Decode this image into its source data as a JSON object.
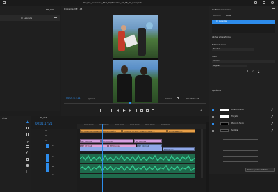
{
  "app": {
    "title_bar": "Projeto_Comissao_ESD_Nl_Trabalho_30_38_31_Completo",
    "accent": "#2d8ceb"
  },
  "left_panel": {
    "title": "ME_118",
    "folder_label": "Cl_Legenda"
  },
  "program_monitor": {
    "title": "Programa: ME_118",
    "timecode_current": "00:01:17:21",
    "fit_label": "Ajustar",
    "quality_label": "Inteira",
    "timecode_total": "00:03:04:16"
  },
  "essential_graphics": {
    "title": "Gráficos essenciais",
    "tab_browse": "Procurar",
    "tab_edit": "Editar",
    "layer_label": "Cl_Legenda",
    "section_align": "Alinhar e transformar",
    "section_styles": "Estilos de Texto",
    "style_value": "Nenhum",
    "section_text": "Texto",
    "font_value": "Verdana",
    "font_style": "Regular",
    "section_appearance": "Aparência",
    "appearance_rows": [
      "Preenchimento",
      "Traçado",
      "Plano de fundo",
      "Sombra"
    ],
    "apply_button": "Definir o padrão de fontes"
  },
  "tools": {
    "title": "Mídia"
  },
  "timeline": {
    "sequence_tab": "ME_118",
    "timecode": "00:01:17:21",
    "ruler_labels": [
      "00:00:45:00",
      "00:01:00:00",
      "00:01:15:00",
      "00:01:30:00",
      "00:01:45:00",
      "00:02:00:00"
    ],
    "track_labels": [
      "V4",
      "V3",
      "V2",
      "V1",
      "A1",
      "A2",
      "A3"
    ],
    "caption_clips": [
      "a coisa chamada aqui ta pedaço além.",
      "Então ali te quis, aprendi coisas ...",
      "a mulheres no..."
    ],
    "v2_clips": [
      "ME_08.mp4",
      "ME_09.mp4",
      "ME_08.mp4"
    ],
    "v1_clips": [
      "ME_07.mp4",
      "ME_08.mp4",
      "ME_09.mp4",
      "ME_09.mp4"
    ],
    "colors": {
      "caption": "#e8a048",
      "v2": "#d7a0e0",
      "v1": "#8fa8e8",
      "audio": "#26a880"
    }
  }
}
